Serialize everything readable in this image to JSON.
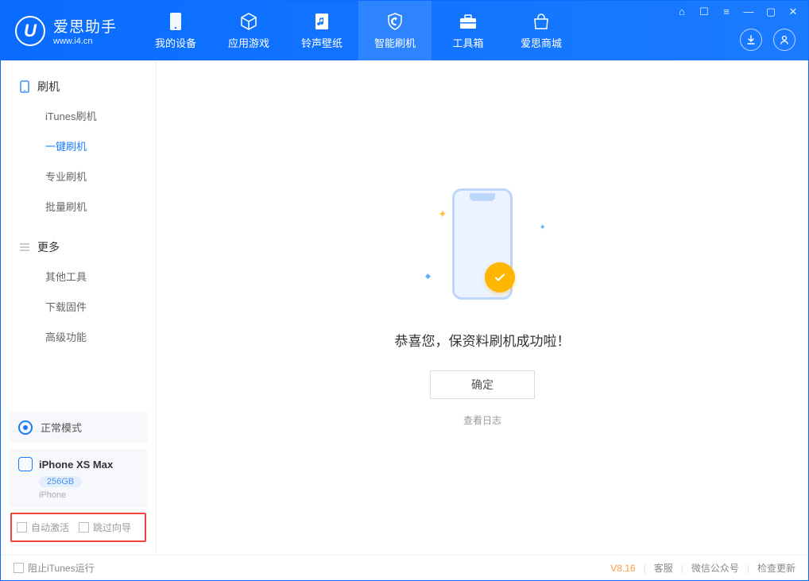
{
  "app": {
    "title": "爱思助手",
    "subtitle": "www.i4.cn"
  },
  "nav": {
    "tabs": [
      "我的设备",
      "应用游戏",
      "铃声壁纸",
      "智能刷机",
      "工具箱",
      "爱思商城"
    ],
    "active_index": 3
  },
  "sidebar": {
    "sections": [
      {
        "title": "刷机",
        "items": [
          "iTunes刷机",
          "一键刷机",
          "专业刷机",
          "批量刷机"
        ],
        "active_index": 1
      },
      {
        "title": "更多",
        "items": [
          "其他工具",
          "下载固件",
          "高级功能"
        ],
        "active_index": -1
      }
    ],
    "status": {
      "label": "正常模式"
    },
    "device": {
      "name": "iPhone XS Max",
      "capacity": "256GB",
      "type": "iPhone"
    },
    "checks": {
      "auto_activate": "自动激活",
      "skip_guide": "跳过向导"
    }
  },
  "main": {
    "success_message": "恭喜您，保资料刷机成功啦！",
    "ok_button": "确定",
    "view_log": "查看日志"
  },
  "footer": {
    "block_itunes": "阻止iTunes运行",
    "version": "V8.16",
    "links": [
      "客服",
      "微信公众号",
      "检查更新"
    ]
  }
}
